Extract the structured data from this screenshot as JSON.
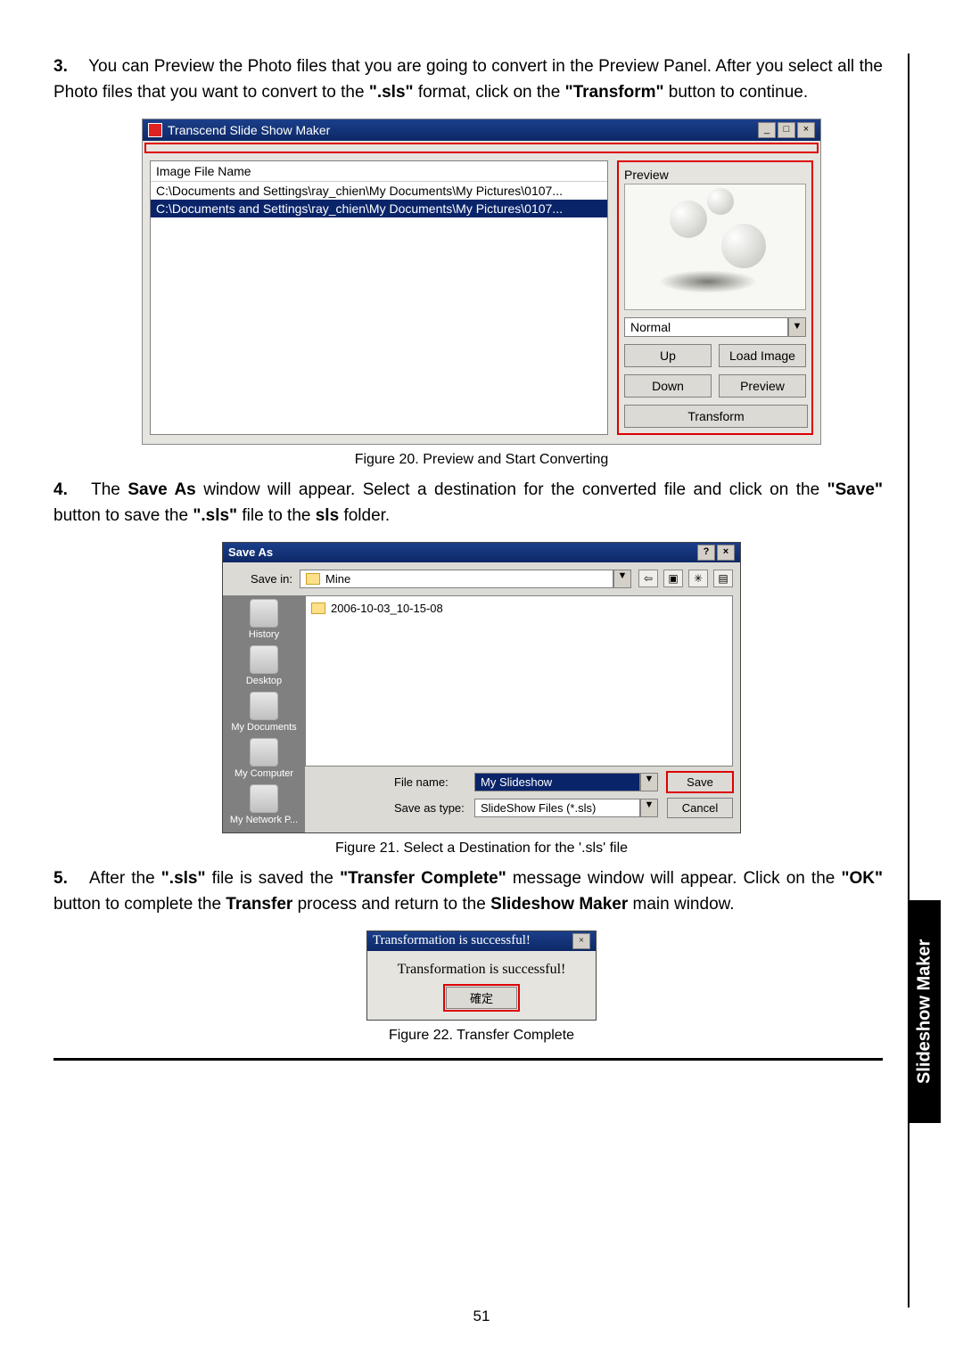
{
  "page_number": "51",
  "sidetab": "Slideshow Maker",
  "step3": {
    "num": "3.",
    "text_1": "You can Preview the Photo files that you are going to convert in the Preview Panel. After you select all the Photo files that you want to convert to the ",
    "bold_sls": "\".sls\"",
    "text_2": " format, click on the ",
    "bold_transform": "\"Transform\"",
    "text_3": " button to continue."
  },
  "fig20": {
    "caption": "Figure 20. Preview and Start Converting",
    "title": "Transcend Slide Show Maker",
    "list_header": "Image File Name",
    "row1": "C:\\Documents and Settings\\ray_chien\\My Documents\\My Pictures\\0107...",
    "row2": "C:\\Documents and Settings\\ray_chien\\My Documents\\My Pictures\\0107...",
    "preview_label": "Preview",
    "rotation": "Normal",
    "btn_up": "Up",
    "btn_load": "Load Image",
    "btn_down": "Down",
    "btn_preview": "Preview",
    "btn_transform": "Transform"
  },
  "step4": {
    "num": "4.",
    "text_1": "The ",
    "bold_saveas": "Save As",
    "text_2": " window will appear. Select a destination for the converted file and click on the ",
    "bold_save": "\"Save\"",
    "text_3": " button to save the ",
    "bold_sls": "\".sls\"",
    "text_4": " file to the ",
    "bold_folder": "sls",
    "text_5": " folder."
  },
  "fig21": {
    "caption": "Figure 21. Select a Destination for the '.sls' file",
    "title": "Save As",
    "savein_label": "Save in:",
    "savein_value": "Mine",
    "list_folder": "2006-10-03_10-15-08",
    "shortcuts": {
      "history": "History",
      "desktop": "Desktop",
      "mydocs": "My Documents",
      "mycomp": "My Computer",
      "mynet": "My Network P..."
    },
    "filename_label": "File name:",
    "filename_value": "My Slideshow",
    "saveas_label": "Save as type:",
    "saveas_value": "SlideShow Files (*.sls)",
    "btn_save": "Save",
    "btn_cancel": "Cancel"
  },
  "step5": {
    "num": "5.",
    "text_1": "After the ",
    "bold_sls": "\".sls\"",
    "text_2": " file is saved the ",
    "bold_tc": "\"Transfer Complete\"",
    "text_3": " message window will appear. Click on the ",
    "bold_ok": "\"OK\"",
    "text_4": " button to complete the ",
    "bold_transfer": "Transfer",
    "text_5": " process and return to the ",
    "bold_sm": "Slideshow Maker",
    "text_6": " main window."
  },
  "fig22": {
    "caption": "Figure 22. Transfer Complete",
    "title": "Transformation is successful!",
    "message": "Transformation is successful!",
    "btn_ok": "確定"
  }
}
